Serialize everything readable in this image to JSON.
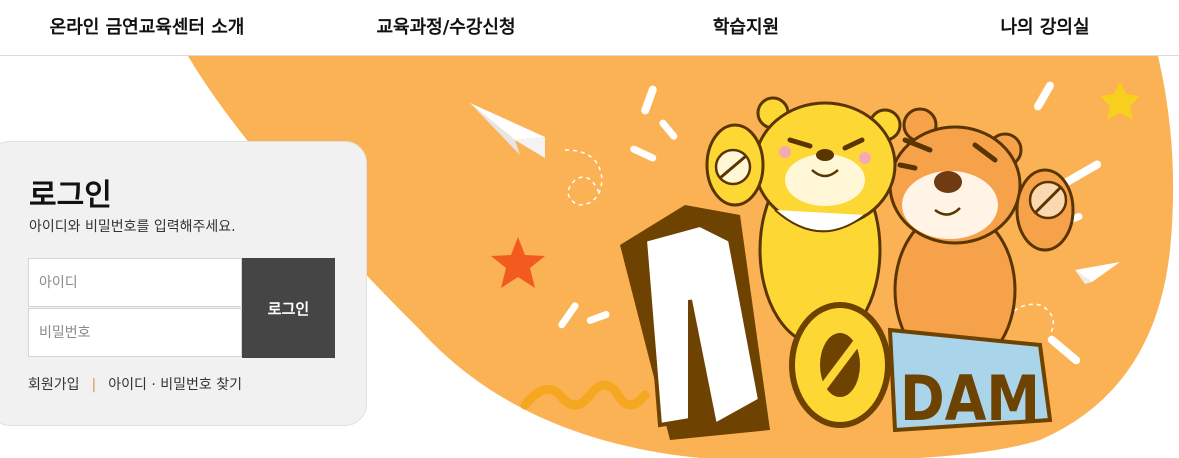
{
  "nav": {
    "items": [
      {
        "label": "온라인 금연교육센터 소개"
      },
      {
        "label": "교육과정/수강신청"
      },
      {
        "label": "학습지원"
      },
      {
        "label": "나의 강의실"
      }
    ]
  },
  "login": {
    "title": "로그인",
    "subtitle": "아이디와 비밀번호를 입력해주세요.",
    "id_placeholder": "아이디",
    "password_placeholder": "비밀번호",
    "button_label": "로그인",
    "signup_link": "회원가입",
    "separator": "|",
    "find_link": "아이디 · 비밀번호 찾기"
  },
  "hero": {
    "logo_text": {
      "big_n": "N",
      "zero": "0",
      "dam": "DAM"
    }
  },
  "colors": {
    "orange_bg": "#fbb254",
    "brown": "#6e4200",
    "yellow": "#fdd835",
    "tiger_orange": "#f6a24a",
    "button_dark": "#454545"
  }
}
